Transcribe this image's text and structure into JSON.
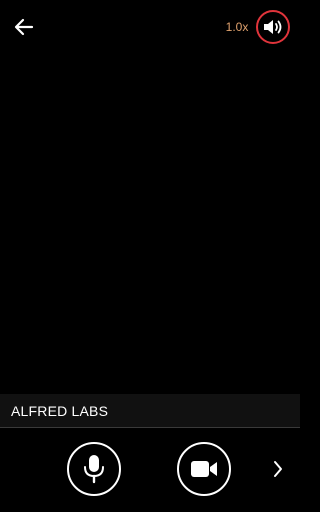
{
  "header": {
    "back_icon": "arrow-left-icon",
    "zoom_level": "1.0x",
    "sound_icon": "speaker-icon",
    "accent_color": "#e0343b",
    "zoom_color": "#e0a26e"
  },
  "camera": {
    "device_name": "ALFRED LABS"
  },
  "controls": {
    "mic_icon": "microphone-icon",
    "camera_icon": "video-camera-icon",
    "next_icon": "chevron-right-icon"
  }
}
